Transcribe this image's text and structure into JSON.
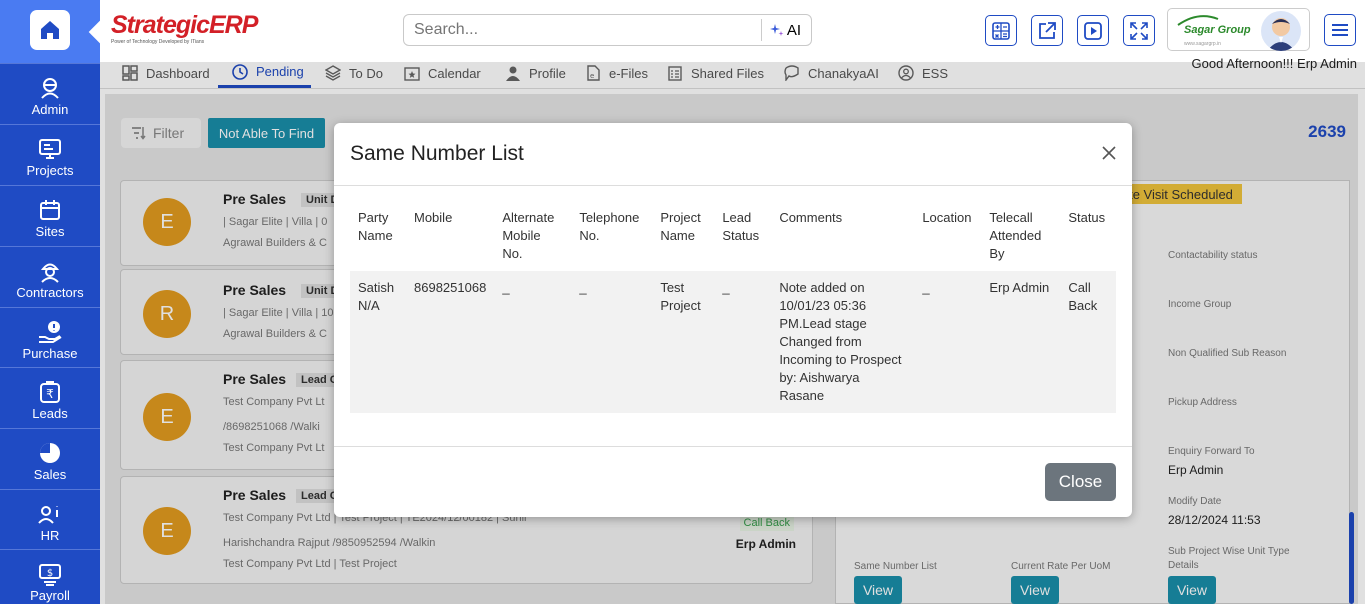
{
  "app": {
    "logo_text": "StrategicERP",
    "logo_tagline": "Power of Technology Developed by ITians"
  },
  "sidebar": {
    "items": [
      {
        "label": "Admin",
        "icon": "admin-icon"
      },
      {
        "label": "Projects",
        "icon": "projects-icon"
      },
      {
        "label": "Sites",
        "icon": "sites-icon"
      },
      {
        "label": "Contractors",
        "icon": "contractors-icon"
      },
      {
        "label": "Purchase",
        "icon": "purchase-icon"
      },
      {
        "label": "Leads",
        "icon": "leads-icon"
      },
      {
        "label": "Sales",
        "icon": "sales-icon"
      },
      {
        "label": "HR",
        "icon": "hr-icon"
      },
      {
        "label": "Payroll",
        "icon": "payroll-icon"
      }
    ]
  },
  "topbar": {
    "search_placeholder": "Search...",
    "ai_label": "AI",
    "group_name": "Sagar Group",
    "group_sub": "www.sagargrp.in"
  },
  "tabs": [
    {
      "label": "Dashboard"
    },
    {
      "label": "Pending"
    },
    {
      "label": "To Do"
    },
    {
      "label": "Calendar"
    },
    {
      "label": "Profile"
    },
    {
      "label": "e-Files"
    },
    {
      "label": "Shared Files"
    },
    {
      "label": "ChanakyaAI"
    },
    {
      "label": "ESS"
    }
  ],
  "greeting": "Good Afternoon!!! Erp Admin",
  "toolbar": {
    "filter_label": "Filter",
    "not_able_label": "Not Able To Find",
    "count": "2639"
  },
  "cards": [
    {
      "initial": "E",
      "title": "Pre Sales",
      "tag": "Unit De",
      "line1": "| Sagar Elite | Villa | 0",
      "line2": "Agrawal Builders & C"
    },
    {
      "initial": "R",
      "title": "Pre Sales",
      "tag": "Unit De",
      "line1": "| Sagar Elite | Villa | 10",
      "line2": "Agrawal Builders & C"
    },
    {
      "initial": "E",
      "title": "Pre Sales",
      "tag": "Lead C",
      "line1": "Test Company Pvt Lt",
      "line2": "/8698251068 /Walki",
      "line3": "Test Company Pvt Lt"
    },
    {
      "initial": "E",
      "title": "Pre Sales",
      "tag": "Lead C",
      "line1": "Test Company Pvt Ltd | Test Project | TE2024/12/00182 | Sunil",
      "line2": "Harishchandra Rajput /9850952594 /Walkin",
      "line3": "Test Company Pvt Ltd | Test Project",
      "badge": "Call Back",
      "user": "Erp Admin"
    }
  ],
  "detail": {
    "status_badge": "te Visit Scheduled",
    "labels": {
      "contactability": "Contactability status",
      "income_group": "Income Group",
      "non_qualified": "Non Qualified Sub Reason",
      "pickup": "Pickup Address",
      "enquiry_forward": "Enquiry Forward To",
      "modify_date": "Modify Date",
      "same_number": "Same Number List",
      "current_rate": "Current Rate Per UoM",
      "sub_project": "Sub Project Wise Unit Type Details"
    },
    "values": {
      "enquiry_forward": "Erp Admin",
      "modify_date": "28/12/2024 11:53"
    },
    "view_label": "View"
  },
  "modal": {
    "title": "Same Number List",
    "columns": [
      "Party Name",
      "Mobile",
      "Alternate Mobile No.",
      "Telephone No.",
      "Project Name",
      "Lead Status",
      "Comments",
      "Location",
      "Telecall Attended By",
      "Status"
    ],
    "rows": [
      [
        "Satish N/A",
        "8698251068",
        "_",
        "_",
        "Test Project",
        "_",
        "Note added on 10/01/23 05:36 PM.Lead stage Changed from Incoming to Prospect by: Aishwarya Rasane",
        "_",
        "Erp Admin",
        "Call Back"
      ]
    ],
    "close_label": "Close"
  }
}
